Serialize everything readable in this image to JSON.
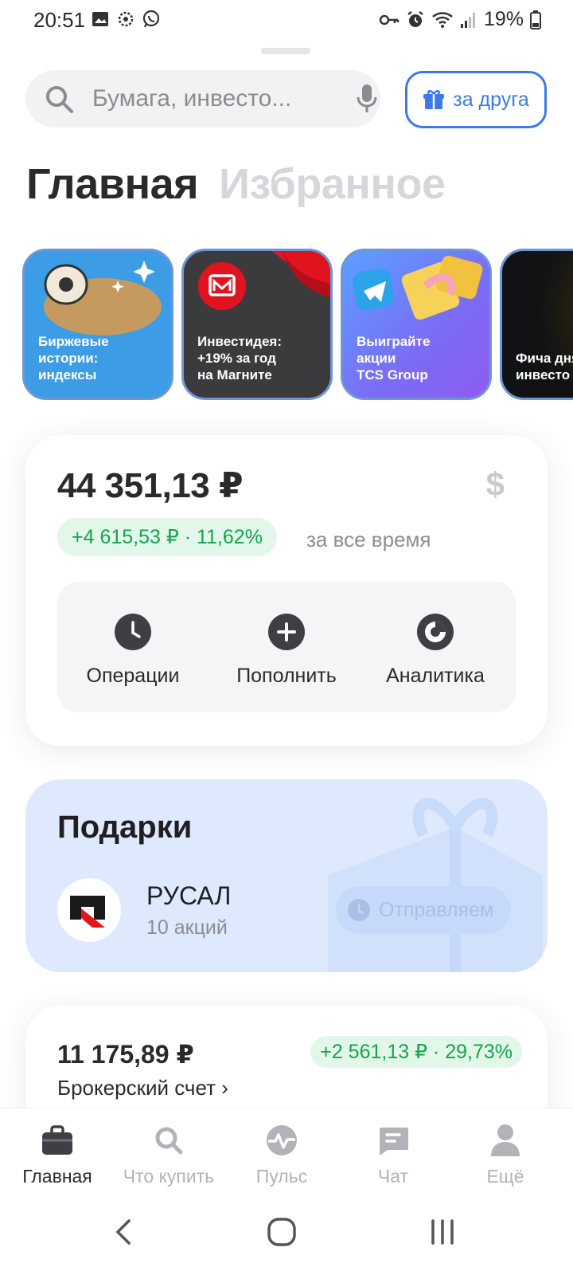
{
  "status_bar": {
    "time": "20:51",
    "battery": "19%",
    "icons_left": [
      "image-icon",
      "settings-bug-icon",
      "whatsapp-icon"
    ],
    "icons_right": [
      "key-icon",
      "alarm-icon",
      "wifi-icon",
      "signal-icon",
      "battery-icon"
    ]
  },
  "search": {
    "placeholder": "Бумага, инвесто..."
  },
  "invite_button": {
    "label": "за друга"
  },
  "tabs": [
    {
      "label": "Главная",
      "active": true
    },
    {
      "label": "Избранное",
      "active": false
    }
  ],
  "stories": [
    {
      "caption": "Биржевые\nистории:\nиндексы",
      "bg": "#3c9ce6"
    },
    {
      "caption": "Инвестидея:\n+19% за год\nна Магните",
      "bg": "#3b3b3d"
    },
    {
      "caption": "Выиграйте\nакции\nTCS Group",
      "bg": "#6d7df5"
    },
    {
      "caption": "Фича дня\nинвесто",
      "bg": "#111214"
    }
  ],
  "portfolio": {
    "total": "44 351,13 ₽",
    "currency_symbol": "$",
    "gain": "+4 615,53 ₽ · 11,62%",
    "gain_period": "за все время",
    "actions": [
      {
        "label": "Операции",
        "icon": "clock-icon"
      },
      {
        "label": "Пополнить",
        "icon": "plus-icon"
      },
      {
        "label": "Аналитика",
        "icon": "donut-chart-icon"
      }
    ]
  },
  "gifts": {
    "title": "Подарки",
    "item_name": "РУСАЛ",
    "item_quantity": "10 акций",
    "status": "Отправляем"
  },
  "broker": {
    "total": "11 175,89 ₽",
    "gain": "+2 561,13 ₽ · 29,73%",
    "name": "Брокерский счет ›"
  },
  "bottom_nav": [
    {
      "label": "Главная",
      "icon": "briefcase-icon",
      "active": true
    },
    {
      "label": "Что купить",
      "icon": "search-icon",
      "active": false
    },
    {
      "label": "Пульс",
      "icon": "pulse-icon",
      "active": false
    },
    {
      "label": "Чат",
      "icon": "chat-icon",
      "active": false
    },
    {
      "label": "Ещё",
      "icon": "profile-icon",
      "active": false
    }
  ],
  "colors": {
    "accent_blue": "#3a7be6",
    "gain_green": "#14a54b",
    "gain_bg": "#e3f6ea",
    "gifts_bg": "#dfe9fd"
  }
}
